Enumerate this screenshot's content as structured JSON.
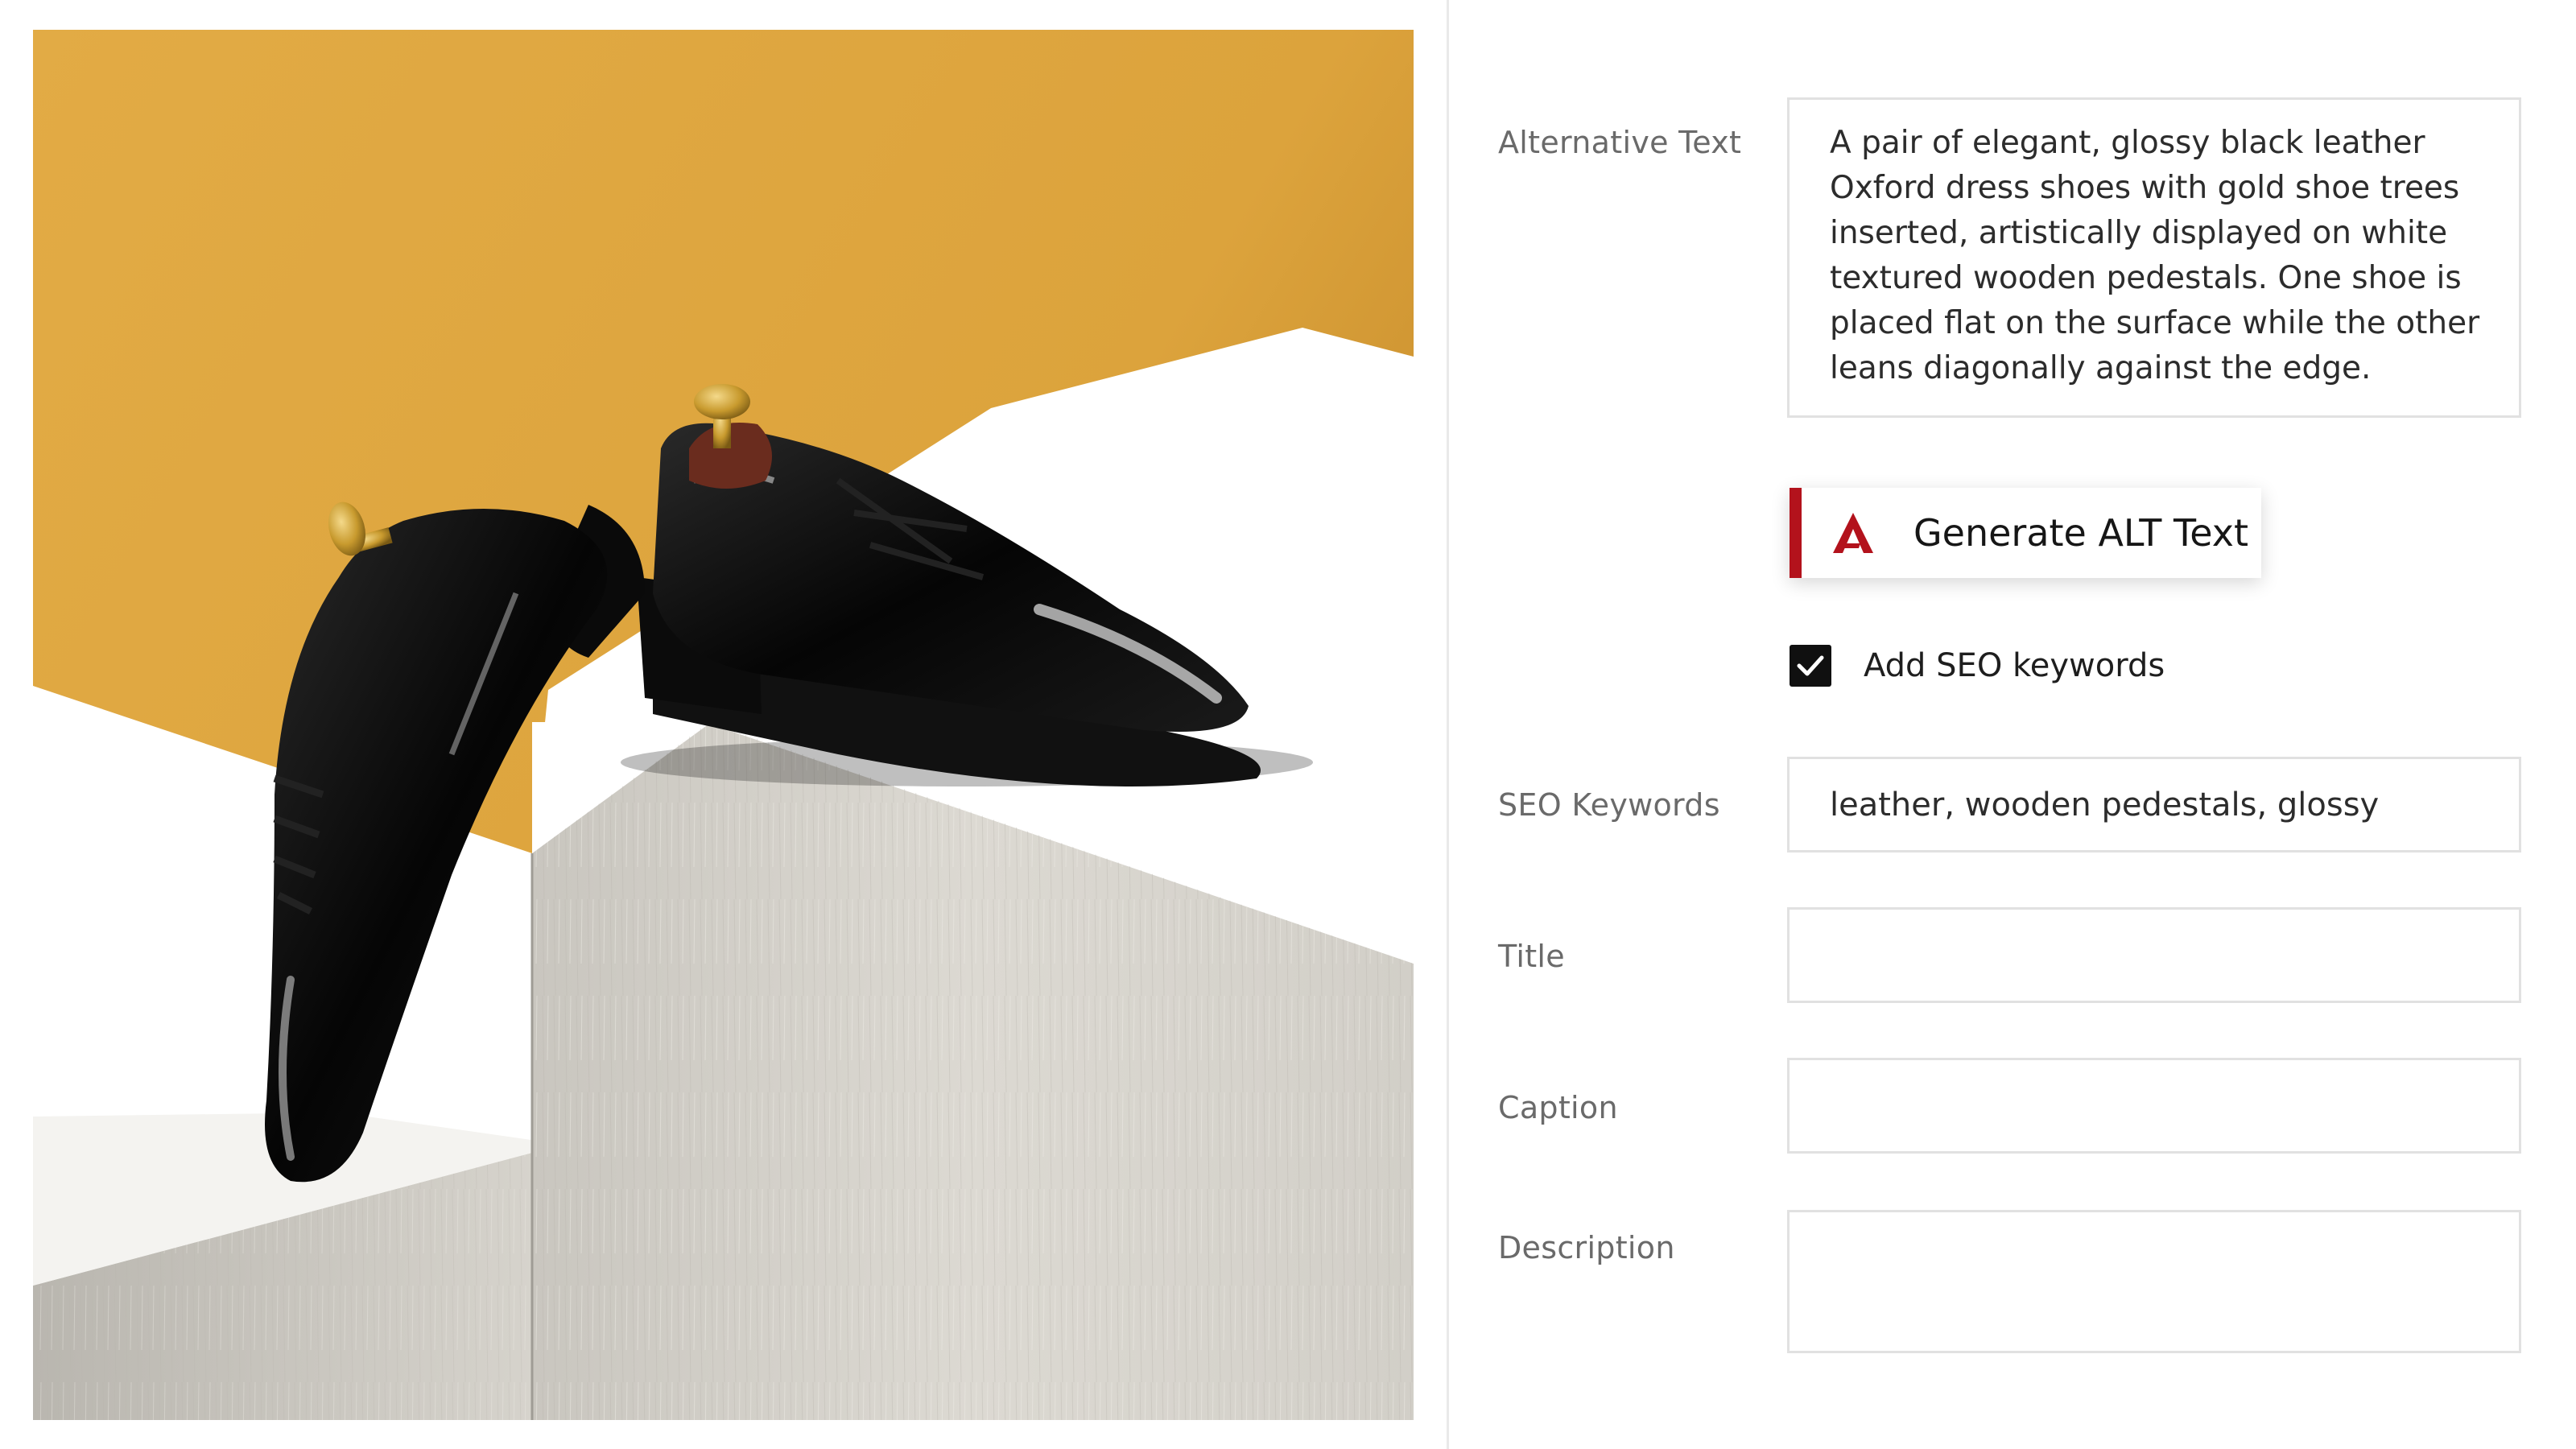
{
  "image": {
    "subject": "black patent leather oxford shoes on white wooden pedestals",
    "background_color": "#dca33c"
  },
  "form": {
    "alt_text": {
      "label": "Alternative Text",
      "value": "A pair of elegant, glossy black leather Oxford dress shoes with gold shoe trees inserted, artistically displayed on white textured wooden pedestals. One shoe is placed flat on the surface while the other leans diagonally against the edge."
    },
    "generate_button": {
      "label": "Generate ALT Text",
      "accent_color": "#b3121c",
      "icon": "brand-a-logo-icon"
    },
    "seo_checkbox": {
      "label": "Add SEO keywords",
      "checked": true
    },
    "seo_keywords": {
      "label": "SEO Keywords",
      "value": "leather, wooden pedestals, glossy"
    },
    "title": {
      "label": "Title",
      "value": ""
    },
    "caption": {
      "label": "Caption",
      "value": ""
    },
    "description": {
      "label": "Description",
      "value": ""
    }
  }
}
